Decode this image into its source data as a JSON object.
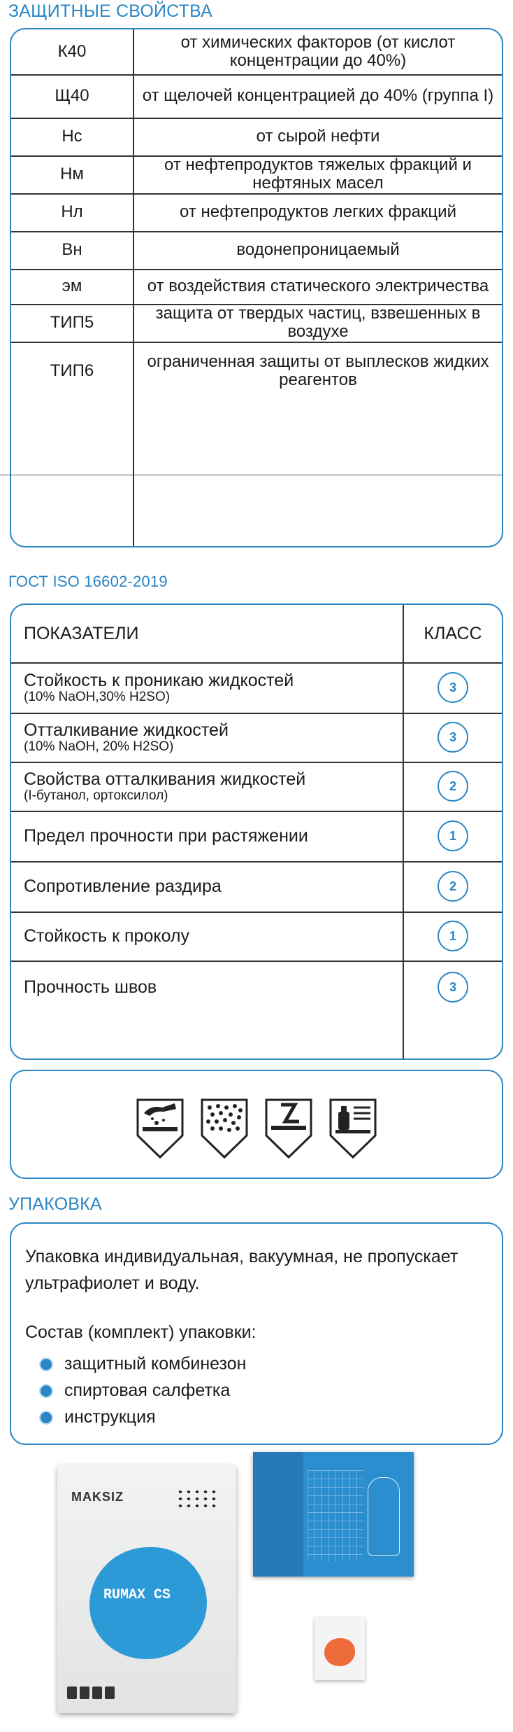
{
  "protective": {
    "title": "ЗАЩИТНЫЕ СВОЙСТВА",
    "rows": [
      {
        "code": "К40",
        "desc": "от химических факторов (от кислот концентрации до 40%)"
      },
      {
        "code": "Щ40",
        "desc": "от щелочей концентрацией до 40% (группа I)"
      },
      {
        "code": "Нс",
        "desc": "от сырой нефти"
      },
      {
        "code": "Нм",
        "desc": "от нефтепродуктов тяжелых фракций и нефтяных масел"
      },
      {
        "code": "Нл",
        "desc": "от нефтепродуктов легких фракций"
      },
      {
        "code": "Вн",
        "desc": "водонепроницаемый"
      },
      {
        "code": "эм",
        "desc": "от воздействия статического электричества"
      },
      {
        "code": "ТИП5",
        "desc": "защита от твердых частиц, взвешенных в воздухе"
      },
      {
        "code": "ТИП6",
        "desc": "ограниченная защиты от выплесков жидких реагентов"
      }
    ]
  },
  "gost": {
    "title": "ГОСТ ISO 16602-2019",
    "header_indicator": "ПОКАЗАТЕЛИ",
    "header_class": "КЛАСС",
    "rows": [
      {
        "name": "Стойкость к проникаю жидкостей",
        "sub": "(10% NaOH,30% H2SO)",
        "class": "3"
      },
      {
        "name": "Отталкивание жидкостей",
        "sub": "(10% NaOH, 20% H2SO)",
        "class": "3"
      },
      {
        "name": "Свойства отталкивания жидкостей",
        "sub": "(I-бутанол, ортоксилол)",
        "class": "2"
      },
      {
        "name": "Предел прочности при растяжении",
        "sub": "",
        "class": "1"
      },
      {
        "name": "Сопротивление раздира",
        "sub": "",
        "class": "2"
      },
      {
        "name": "Стойкость к проколу",
        "sub": "",
        "class": "1"
      },
      {
        "name": "Прочность швов",
        "sub": "",
        "class": "3"
      }
    ]
  },
  "pictograms": [
    "chemical-splash-icon",
    "particles-icon",
    "abrasion-icon",
    "liquid-spray-icon"
  ],
  "packaging": {
    "title": "УПАКОВКА",
    "text": "Упаковка индивидуальная, вакуумная, не пропускает ультрафиолет и воду.",
    "contents_label": "Состав (комплект) упаковки:",
    "items": [
      "защитный комбинезон",
      "спиртовая салфетка",
      "инструкция"
    ]
  },
  "product": {
    "brand": "MAKSIZ",
    "name": "RUMAX CS"
  },
  "colors": {
    "accent": "#2a86c4"
  }
}
